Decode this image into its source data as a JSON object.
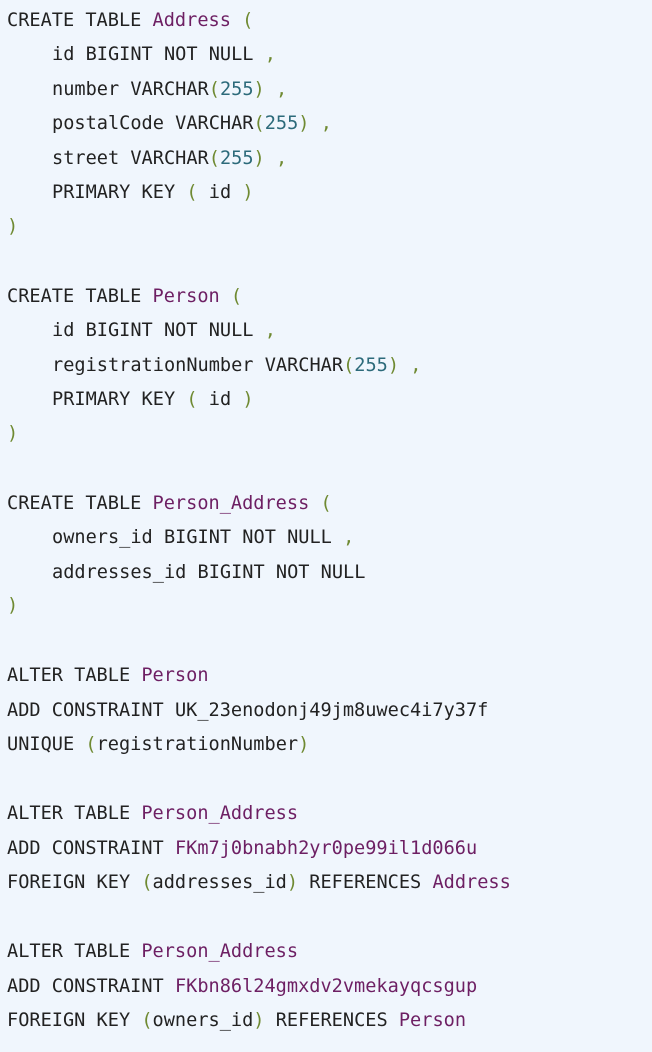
{
  "blocks": [
    {
      "header": {
        "kw": "CREATE TABLE",
        "name": "Address",
        "open": "("
      },
      "cols": [
        {
          "def": "id BIGINT NOT NULL",
          "sep": ","
        },
        {
          "pre": "number VARCHAR",
          "lp": "(",
          "num": "255",
          "rp": ")",
          "sep": ","
        },
        {
          "pre": "postalCode VARCHAR",
          "lp": "(",
          "num": "255",
          "rp": ")",
          "sep": ","
        },
        {
          "pre": "street VARCHAR",
          "lp": "(",
          "num": "255",
          "rp": ")",
          "sep": ","
        },
        {
          "pk": "PRIMARY KEY",
          "lp": "(",
          "col": "id",
          "rp": ")"
        }
      ],
      "close": ")"
    },
    {
      "header": {
        "kw": "CREATE TABLE",
        "name": "Person",
        "open": "("
      },
      "cols": [
        {
          "def": "id BIGINT NOT NULL",
          "sep": ","
        },
        {
          "pre": "registrationNumber VARCHAR",
          "lp": "(",
          "num": "255",
          "rp": ")",
          "sep": ","
        },
        {
          "pk": "PRIMARY KEY",
          "lp": "(",
          "col": "id",
          "rp": ")"
        }
      ],
      "close": ")"
    },
    {
      "header": {
        "kw": "CREATE TABLE",
        "name": "Person_Address",
        "open": "("
      },
      "cols": [
        {
          "def": "owners_id BIGINT NOT NULL",
          "sep": ","
        },
        {
          "def": "addresses_id BIGINT NOT NULL"
        }
      ],
      "close": ")"
    }
  ],
  "alters": [
    {
      "kw": "ALTER TABLE",
      "table": "Person",
      "add": "ADD CONSTRAINT",
      "constraint": "UK_23enodonj49jm8uwec4i7y37f",
      "type": "UNIQUE",
      "lp": "(",
      "col": "registrationNumber",
      "rp": ")"
    },
    {
      "kw": "ALTER TABLE",
      "table": "Person_Address",
      "add": "ADD CONSTRAINT",
      "constraint": "FKm7j0bnabh2yr0pe99il1d066u",
      "type": "FOREIGN KEY",
      "lp": "(",
      "col": "addresses_id",
      "rp": ")",
      "ref": "REFERENCES",
      "ref_table": "Address"
    },
    {
      "kw": "ALTER TABLE",
      "table": "Person_Address",
      "add": "ADD CONSTRAINT",
      "constraint": "FKbn86l24gmxdv2vmekayqcsgup",
      "type": "FOREIGN KEY",
      "lp": "(",
      "col": "owners_id",
      "rp": ")",
      "ref": "REFERENCES",
      "ref_table": "Person"
    }
  ]
}
